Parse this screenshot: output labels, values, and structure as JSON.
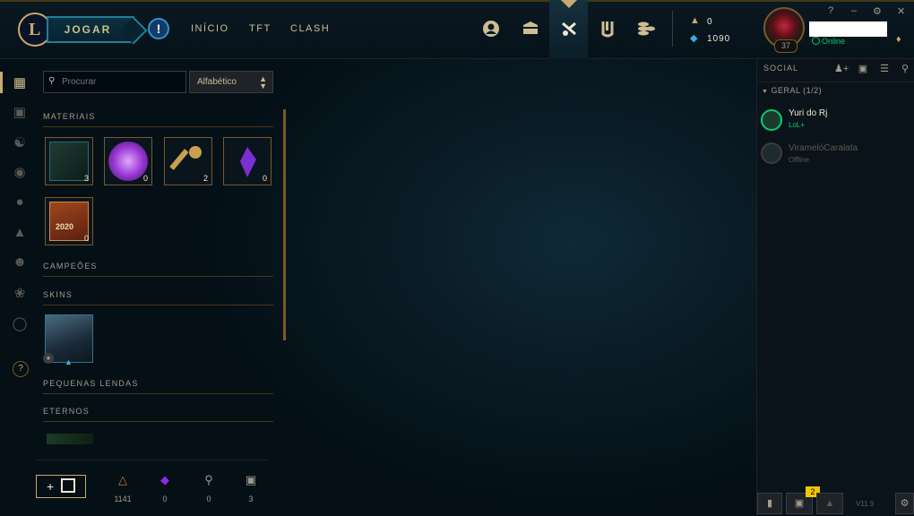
{
  "topbar": {
    "play_label": "JOGAR",
    "alert_glyph": "!",
    "nav": [
      "INÍCIO",
      "TFT",
      "CLASH"
    ],
    "icons": [
      "profile-icon",
      "collection-chest-icon",
      "loot-icon",
      "store-icon",
      "currency-icon"
    ],
    "orange_essence": "0",
    "blue_essence": "1090",
    "window_controls": [
      "?",
      "–",
      "⚙",
      "✕"
    ]
  },
  "profile": {
    "level": "37",
    "status": "Online"
  },
  "collection": {
    "search_placeholder": "Procurar",
    "sort_value": "Alfabético",
    "sections": {
      "materiais": "MATERIAIS",
      "campeoes": "CAMPEÕES",
      "skins": "SKINS",
      "pequenas": "PEQUENAS LENDAS",
      "eternos": "ETERNOS"
    },
    "materials": [
      {
        "name": "hextech-chest",
        "count": "3"
      },
      {
        "name": "orb",
        "count": "0"
      },
      {
        "name": "key-fragment",
        "count": "2"
      },
      {
        "name": "mythic-essence",
        "count": "0"
      },
      {
        "name": "event-token-2020",
        "count": "0",
        "label": "2020"
      }
    ],
    "bottom_bar": {
      "craft_label": "+",
      "orange_essence": "1141",
      "mythic": "0",
      "keys": "0",
      "chests": "3"
    }
  },
  "social": {
    "title": "SOCIAL",
    "group": "GERAL (1/2)",
    "friends": [
      {
        "name": "Yuri do Rj",
        "status": "LoL+"
      },
      {
        "name": "ViramelóCaralata",
        "status": "Offline"
      }
    ],
    "badge_count": "2",
    "version": "V11.9"
  },
  "colors": {
    "gold": "#c8aa6e",
    "online_green": "#0acb6e",
    "mythic_purple": "#8a2be2",
    "badge_yellow": "#f0c800"
  }
}
